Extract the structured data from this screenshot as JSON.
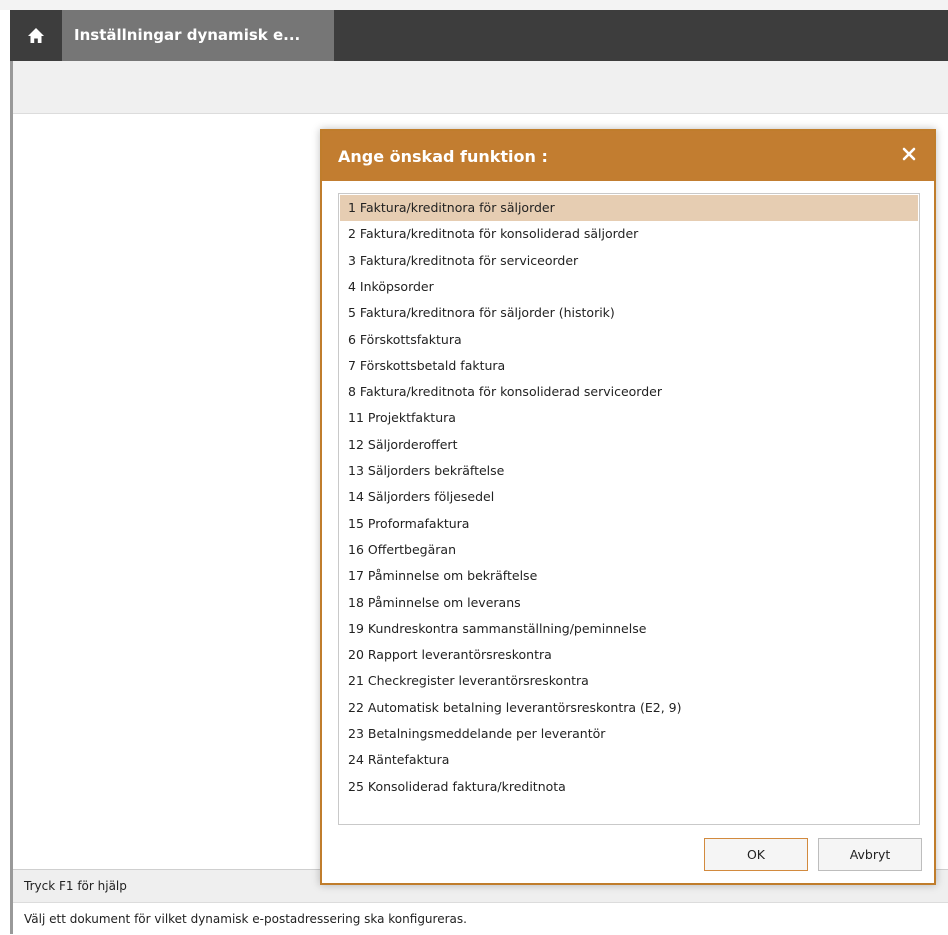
{
  "app": {
    "tab_title": "Inställningar dynamisk e..."
  },
  "icons": {
    "home": "home-icon",
    "close": "close-icon"
  },
  "colors": {
    "tabbar": "#3d3d3d",
    "active_tab": "#767676",
    "dialog_accent": "#c27d30",
    "selection": "#e6cdb2"
  },
  "dialog": {
    "title": "Ange önskad funktion :",
    "items": [
      "1  Faktura/kreditnora för säljorder",
      "2  Faktura/kreditnota för konsoliderad säljorder",
      "3  Faktura/kreditnota för serviceorder",
      "4  Inköpsorder",
      "5  Faktura/kreditnora för säljorder (historik)",
      "6  Förskottsfaktura",
      "7  Förskottsbetald faktura",
      "8  Faktura/kreditnota för konsoliderad serviceorder",
      "11  Projektfaktura",
      "12 Säljorderoffert",
      "13  Säljorders bekräftelse",
      "14  Säljorders följesedel",
      "15  Proformafaktura",
      "16  Offertbegäran",
      "17  Påminnelse om bekräftelse",
      "18  Påminnelse om leverans",
      "19  Kundreskontra sammanställning/peminnelse",
      "20  Rapport leverantörsreskontra",
      "21  Checkregister leverantörsreskontra",
      "22  Automatisk betalning leverantörsreskontra (E2, 9)",
      "23  Betalningsmeddelande per leverantör",
      "24  Räntefaktura",
      "25  Konsoliderad faktura/kreditnota"
    ],
    "selected_index": 0,
    "ok_label": "OK",
    "cancel_label": "Avbryt"
  },
  "status": {
    "help": "Tryck F1 för hjälp",
    "info": "Välj ett dokument för vilket dynamisk e-postadressering ska konfigureras."
  }
}
